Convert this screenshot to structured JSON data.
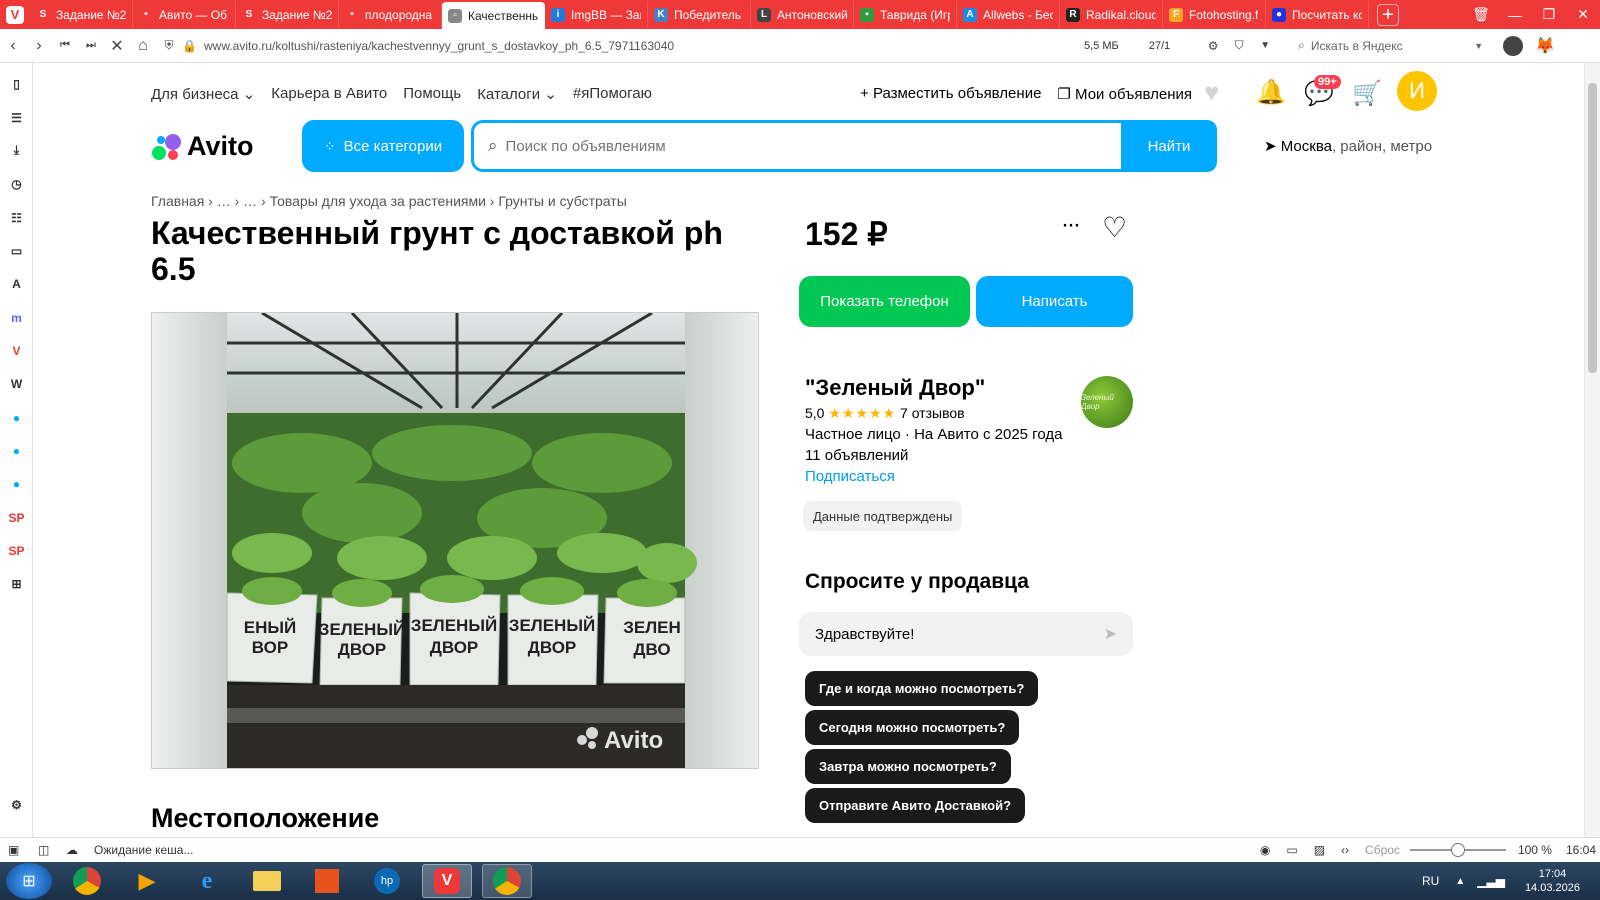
{
  "browser": {
    "tabs": [
      {
        "label": "Задание №2",
        "color": "#ef3939",
        "glyph": "S"
      },
      {
        "label": "Авито — Об",
        "color": "#ef3939",
        "glyph": "•"
      },
      {
        "label": "Задание №2",
        "color": "#ef3939",
        "glyph": "S"
      },
      {
        "label": "плодородна",
        "color": "#ef3939",
        "glyph": "•"
      },
      {
        "label": "Качественны",
        "color": "#888888",
        "glyph": "▫"
      },
      {
        "label": "ImgBB — Заг",
        "color": "#1f7ae0",
        "glyph": "i"
      },
      {
        "label": "Победитель",
        "color": "#4680c2",
        "glyph": "K"
      },
      {
        "label": "Антоновский",
        "color": "#444444",
        "glyph": "L"
      },
      {
        "label": "Таврида (Игр",
        "color": "#2e9b3f",
        "glyph": "▪"
      },
      {
        "label": "Allwebs - Бес",
        "color": "#1e88e5",
        "glyph": "A"
      },
      {
        "label": "Radikal.cloud",
        "color": "#222222",
        "glyph": "R"
      },
      {
        "label": "Fotohosting.f",
        "color": "#f5a623",
        "glyph": "F"
      },
      {
        "label": "Посчитать ко",
        "color": "#2431d9",
        "glyph": "●"
      }
    ],
    "url": "www.avito.ru/koltushi/rasteniya/kachestvennyy_grunt_s_dostavkoy_ph_6.5_7971163040",
    "page_size": "5,5 МБ",
    "counter": "27/1",
    "search_placeholder": "Искать в Яндекс",
    "status_text": "Ожидание кеша...",
    "reset_label": "Сброс",
    "zoom": "100 %",
    "time_status": "16:04",
    "zoom_level": 0.5
  },
  "taskbar": {
    "lang": "RU",
    "time": "17:04",
    "date": "14.03.2026"
  },
  "header": {
    "nav": [
      "Для бизнеса",
      "Карьера в Авито",
      "Помощь",
      "Каталоги",
      "#яПомогаю"
    ],
    "post_ad": "Разместить объявление",
    "my_ads": "Мои объявления",
    "messages_badge": "99+",
    "avatar_letter": "И",
    "logo": "Avito",
    "categories_btn": "Все категории",
    "search_placeholder": "Поиск по объявлениям",
    "search_btn": "Найти",
    "location_city": "Москва",
    "location_rest": ", район, метро"
  },
  "listing": {
    "breadcrumbs": "Главная  ›  …  ›  …  ›  Товары для ухода за растениями  ›  Грунты и субстраты",
    "title": "Качественный грунт с доставкой ph 6.5",
    "price": "152 ₽",
    "show_phone": "Показать телефон",
    "write": "Написать",
    "location_heading": "Местоположение",
    "bag_text": "ЗЕЛЕНЫЙ ДВОР",
    "watermark": "Avito"
  },
  "seller": {
    "name": "\"Зеленый Двор\"",
    "rating": "5,0",
    "stars": "★★★★★",
    "reviews": "7 отзывов",
    "info": "Частное лицо · На Авито с 2025 года",
    "ads": "11 объявлений",
    "subscribe": "Подписаться",
    "verified": "Данные подтверждены",
    "avatar_text": "Зеленый Двор"
  },
  "ask": {
    "heading": "Спросите у продавца",
    "input_value": "Здравствуйте!",
    "chips": [
      "Где и когда можно посмотреть?",
      "Сегодня можно посмотреть?",
      "Завтра можно посмотреть?",
      "Отправите Авито Доставкой?"
    ]
  }
}
